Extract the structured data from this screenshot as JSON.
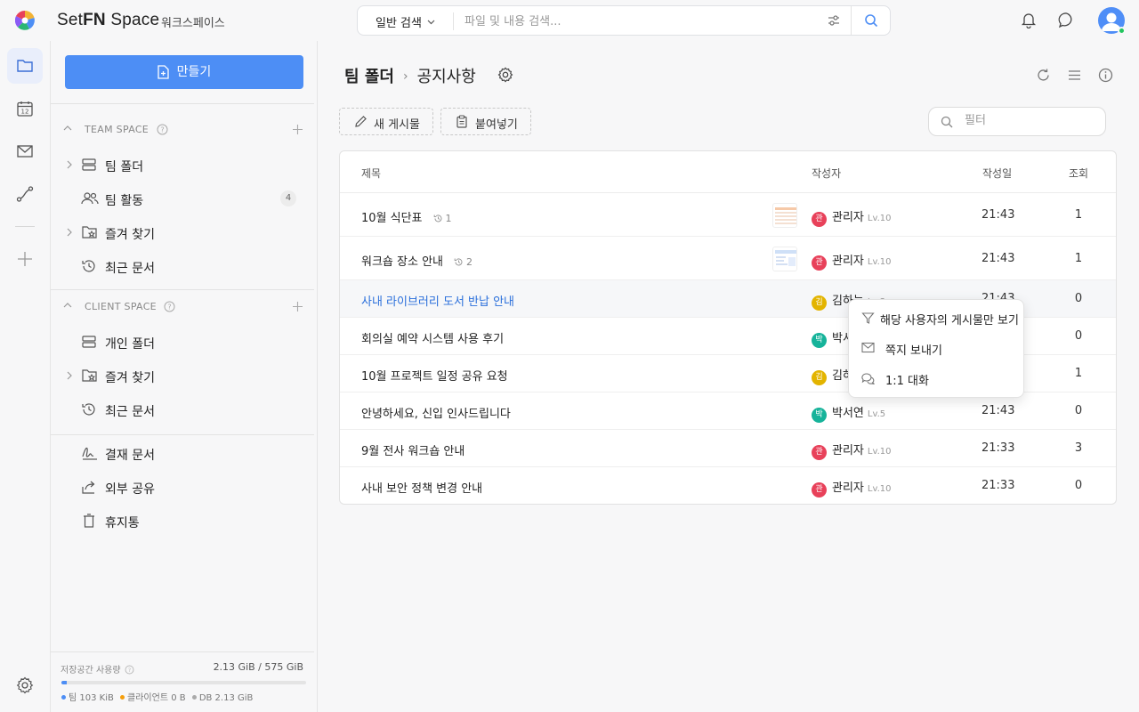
{
  "app": {
    "brand_prefix": "Set",
    "brand_fn": "FN",
    "brand_suffix": " Space",
    "workspace": "워크스페이스"
  },
  "colors": {
    "accent": "#4d8ef5",
    "link": "#2a6fdb",
    "badge_red": "#e8415a",
    "badge_yellow": "#e3b400",
    "badge_teal": "#16b39a",
    "online": "#22c55e"
  },
  "search": {
    "type": "일반 검색",
    "placeholder": "파일 및 내용 검색..."
  },
  "sidebar": {
    "create_label": "만들기",
    "team_space": {
      "title": "TEAM SPACE",
      "items": [
        {
          "label": "팀 폴더",
          "icon": "server-icon"
        },
        {
          "label": "팀 활동",
          "icon": "users-icon",
          "count": "4"
        },
        {
          "label": "즐겨 찾기",
          "icon": "star-folder-icon"
        },
        {
          "label": "최근 문서",
          "icon": "history-icon"
        }
      ]
    },
    "client_space": {
      "title": "CLIENT SPACE",
      "items": [
        {
          "label": "개인 폴더",
          "icon": "server-icon"
        },
        {
          "label": "즐겨 찾기",
          "icon": "star-folder-icon"
        },
        {
          "label": "최근 문서",
          "icon": "history-icon"
        }
      ]
    },
    "extra": [
      {
        "label": "결재 문서",
        "icon": "signature-icon"
      },
      {
        "label": "외부 공유",
        "icon": "share-icon"
      },
      {
        "label": "휴지통",
        "icon": "trash-icon"
      }
    ],
    "storage": {
      "label": "저장공간 사용량",
      "amount": "2.13 GiB / 575 GiB",
      "fraction": 0.02,
      "legend_team": "팀 103 KiB",
      "legend_client": "클라이언트 0 B",
      "legend_db": "DB 2.13 GiB"
    }
  },
  "main": {
    "breadcrumb_root": "팀 폴더",
    "breadcrumb_current": "공지사항",
    "new_post": "새 게시물",
    "paste": "붙여넣기",
    "filter_placeholder": "필터",
    "columns": {
      "title": "제목",
      "author": "작성자",
      "date": "작성일",
      "views": "조회"
    },
    "rows": [
      {
        "title": "10월 식단표",
        "rev": "1",
        "thumb": true,
        "badge": "관",
        "badge_color": "#e8415a",
        "author": "관리자",
        "lv": "Lv.10",
        "date": "21:43",
        "views": "1"
      },
      {
        "title": "워크숍 장소 안내",
        "rev": "2",
        "thumb": true,
        "badge": "관",
        "badge_color": "#e8415a",
        "author": "관리자",
        "lv": "Lv.10",
        "date": "21:43",
        "views": "1"
      },
      {
        "title": "사내 라이브러리 도서 반납 안내",
        "badge": "김",
        "badge_color": "#e3b400",
        "author": "김하늘",
        "lv": "Lv.3",
        "date": "21:43",
        "views": "0"
      },
      {
        "title": "회의실 예약 시스템 사용 후기",
        "badge": "박",
        "badge_color": "#16b39a",
        "author": "박서연",
        "lv": "Lv.5",
        "date": "21:43",
        "views": "0"
      },
      {
        "title": "10월 프로젝트 일정 공유 요청",
        "badge": "김",
        "badge_color": "#e3b400",
        "author": "김하늘",
        "lv": "Lv.3",
        "date": "21:43",
        "views": "1"
      },
      {
        "title": "안녕하세요, 신입 인사드립니다",
        "badge": "박",
        "badge_color": "#16b39a",
        "author": "박서연",
        "lv": "Lv.5",
        "date": "21:43",
        "views": "0"
      },
      {
        "title": "9월 전사 워크숍 안내",
        "badge": "관",
        "badge_color": "#e8415a",
        "author": "관리자",
        "lv": "Lv.10",
        "date": "21:33",
        "views": "3"
      },
      {
        "title": "사내 보안 정책 변경 안내",
        "badge": "관",
        "badge_color": "#e8415a",
        "author": "관리자",
        "lv": "Lv.10",
        "date": "21:33",
        "views": "0"
      }
    ]
  },
  "context_menu": {
    "items": [
      {
        "label": "해당 사용자의 게시물만 보기",
        "icon": "filter-icon"
      },
      {
        "label": "쪽지 보내기",
        "icon": "mail-icon"
      },
      {
        "label": "1:1 대화",
        "icon": "chat-icon"
      }
    ]
  }
}
